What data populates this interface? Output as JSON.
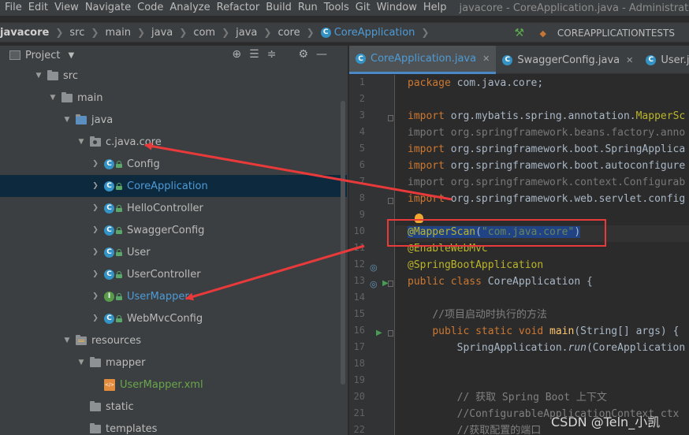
{
  "menubar": {
    "items": [
      "File",
      "Edit",
      "View",
      "Navigate",
      "Code",
      "Analyze",
      "Refactor",
      "Build",
      "Run",
      "Tools",
      "Git",
      "Window",
      "Help"
    ],
    "window_title": "javacore - CoreApplication.java - Administrato"
  },
  "breadcrumb": {
    "items": [
      "javacore",
      "src",
      "main",
      "java",
      "com",
      "java",
      "core"
    ],
    "active": "CoreApplication",
    "run_config": "COREAPPLICATIONTESTS"
  },
  "project": {
    "title": "Project",
    "tree": [
      {
        "label": "src",
        "indent": 1,
        "type": "folder",
        "expanded": true
      },
      {
        "label": "main",
        "indent": 2,
        "type": "folder",
        "expanded": true
      },
      {
        "label": "java",
        "indent": 3,
        "type": "folder-blue",
        "expanded": true
      },
      {
        "label": "c.java.core",
        "indent": 4,
        "type": "package",
        "expanded": true
      },
      {
        "label": "Config",
        "indent": 5,
        "type": "class"
      },
      {
        "label": "CoreApplication",
        "indent": 5,
        "type": "class-run",
        "selected": true
      },
      {
        "label": "HelloController",
        "indent": 5,
        "type": "class"
      },
      {
        "label": "SwaggerConfig",
        "indent": 5,
        "type": "class"
      },
      {
        "label": "User",
        "indent": 5,
        "type": "class"
      },
      {
        "label": "UserController",
        "indent": 5,
        "type": "class"
      },
      {
        "label": "UserMapper",
        "indent": 5,
        "type": "interface"
      },
      {
        "label": "WebMvcConfig",
        "indent": 5,
        "type": "class"
      },
      {
        "label": "resources",
        "indent": 3,
        "type": "folder-res",
        "expanded": true
      },
      {
        "label": "mapper",
        "indent": 4,
        "type": "folder",
        "expanded": true
      },
      {
        "label": "UserMapper.xml",
        "indent": 5,
        "type": "xml"
      },
      {
        "label": "static",
        "indent": 4,
        "type": "folder"
      },
      {
        "label": "templates",
        "indent": 4,
        "type": "folder"
      }
    ]
  },
  "tabs": [
    {
      "label": "CoreApplication.java",
      "active": true,
      "icon": "C"
    },
    {
      "label": "SwaggerConfig.java",
      "active": false,
      "icon": "C"
    },
    {
      "label": "User.java",
      "active": false,
      "icon": "C"
    }
  ],
  "editor": {
    "line_numbers": [
      "1",
      "2",
      "3",
      "4",
      "5",
      "6",
      "7",
      "8",
      "9",
      "10",
      "11",
      "12",
      "13",
      "14",
      "15",
      "16",
      "17",
      "18",
      "19",
      "20",
      "21",
      "22"
    ],
    "lines": [
      {
        "n": 1,
        "tokens": [
          [
            "kw",
            "package "
          ],
          [
            "pk",
            "com.java.core;"
          ]
        ]
      },
      {
        "n": 2,
        "tokens": []
      },
      {
        "n": 3,
        "tokens": [
          [
            "kw",
            "import "
          ],
          [
            "pk",
            "org.mybatis.spring.annotation."
          ],
          [
            "ann",
            "MapperSc"
          ]
        ]
      },
      {
        "n": 4,
        "tokens": [
          [
            "gray",
            "import org.springframework.beans.factory.anno"
          ]
        ]
      },
      {
        "n": 5,
        "tokens": [
          [
            "kw",
            "import "
          ],
          [
            "pk",
            "org.springframework.boot.SpringApplica"
          ]
        ]
      },
      {
        "n": 6,
        "tokens": [
          [
            "kw",
            "import "
          ],
          [
            "pk",
            "org.springframework.boot.autoconfigure"
          ]
        ]
      },
      {
        "n": 7,
        "tokens": [
          [
            "gray",
            "import org.springframework.context.Configurab"
          ]
        ]
      },
      {
        "n": 8,
        "tokens": [
          [
            "kw",
            "import "
          ],
          [
            "pk",
            "org.springframework.web.servlet.config"
          ]
        ]
      },
      {
        "n": 9,
        "tokens": []
      },
      {
        "n": 10,
        "tokens": [
          [
            "ann sel",
            "@MapperScan"
          ],
          [
            "pk sel",
            "("
          ],
          [
            "str sel",
            "\"com.java.core\""
          ],
          [
            "pk sel",
            ")"
          ]
        ]
      },
      {
        "n": 11,
        "tokens": [
          [
            "ann",
            "@EnableWebMvc"
          ]
        ]
      },
      {
        "n": 12,
        "tokens": [
          [
            "ann",
            "@SpringBootApplication"
          ]
        ]
      },
      {
        "n": 13,
        "tokens": [
          [
            "kw",
            "public class "
          ],
          [
            "pk",
            "CoreApplication {"
          ]
        ]
      },
      {
        "n": 14,
        "tokens": []
      },
      {
        "n": 15,
        "tokens": [
          [
            "pk",
            "    "
          ],
          [
            "cmt",
            "//项目启动时执行的方法"
          ]
        ]
      },
      {
        "n": 16,
        "tokens": [
          [
            "pk",
            "    "
          ],
          [
            "kw",
            "public static void "
          ],
          [
            "method",
            "main"
          ],
          [
            "pk",
            "(String[] args) {"
          ]
        ]
      },
      {
        "n": 17,
        "tokens": [
          [
            "pk",
            "        SpringApplication."
          ],
          [
            "pk it",
            "run"
          ],
          [
            "pk",
            "(CoreApplication"
          ]
        ]
      },
      {
        "n": 18,
        "tokens": []
      },
      {
        "n": 19,
        "tokens": []
      },
      {
        "n": 20,
        "tokens": [
          [
            "pk",
            "        "
          ],
          [
            "cmt",
            "// 获取 Spring Boot 上下文"
          ]
        ]
      },
      {
        "n": 21,
        "tokens": [
          [
            "pk",
            "        "
          ],
          [
            "cmt",
            "//ConfigurableApplicationContext ctx"
          ]
        ]
      },
      {
        "n": 22,
        "tokens": [
          [
            "pk",
            "        "
          ],
          [
            "cmt",
            "//获取配置的端口"
          ]
        ]
      }
    ]
  },
  "watermark": "CSDN @Teln_小凯",
  "colors": {
    "annotation_red": "#e83a3a",
    "selection": "#214283"
  }
}
